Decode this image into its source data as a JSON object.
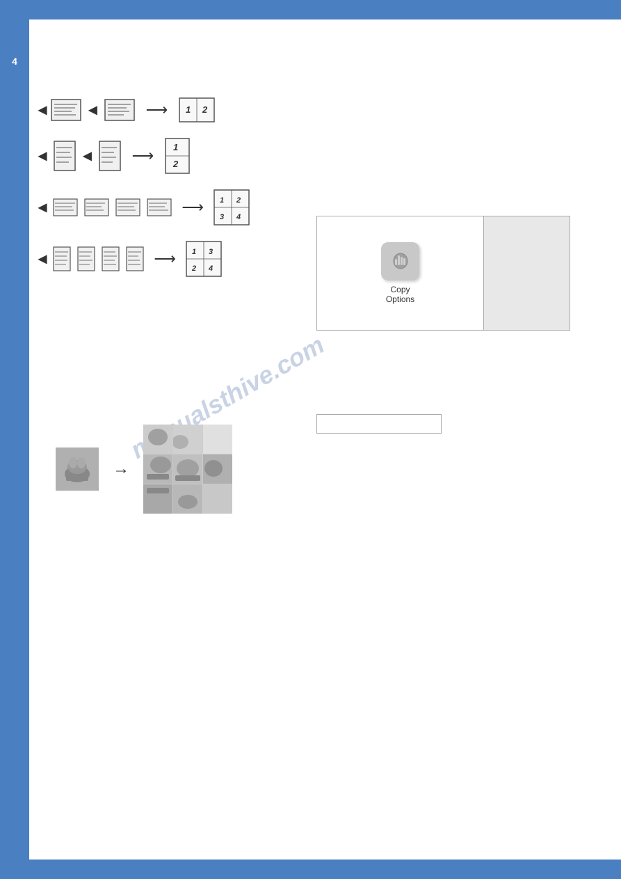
{
  "page": {
    "title": "Copy Options",
    "page_number": "4",
    "watermark_text": "manualsthive.com"
  },
  "section_title": {
    "text": ""
  },
  "diagrams": {
    "row1": {
      "label": "2-up horizontal",
      "sources": [
        "landscape",
        "landscape"
      ],
      "output": [
        [
          "1",
          "2"
        ]
      ]
    },
    "row2": {
      "label": "2-up vertical",
      "sources": [
        "portrait",
        "portrait"
      ],
      "output": [
        [
          "1"
        ],
        [
          "2"
        ]
      ]
    },
    "row3": {
      "label": "4-up horizontal",
      "sources": [
        "landscape",
        "landscape",
        "landscape",
        "landscape"
      ],
      "output": [
        [
          "1",
          "2"
        ],
        [
          "3",
          "4"
        ]
      ]
    },
    "row4": {
      "label": "4-up vertical",
      "sources": [
        "portrait",
        "portrait",
        "portrait",
        "portrait"
      ],
      "output": [
        [
          "1",
          "3"
        ],
        [
          "2",
          "4"
        ]
      ]
    }
  },
  "copy_options_panel": {
    "button_label": "Copy\nOptions",
    "icon_symbol": "⚙"
  },
  "label_box": {
    "text": ""
  },
  "poster": {
    "description": "Poster copy enlargement diagram"
  }
}
